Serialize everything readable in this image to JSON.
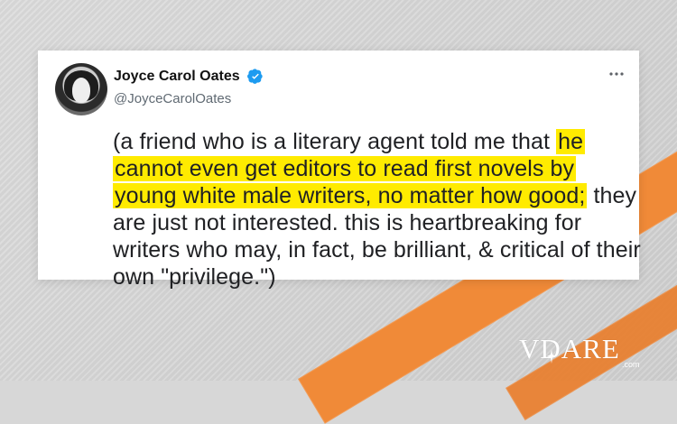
{
  "tweet": {
    "author_name": "Joyce Carol Oates",
    "handle": "@JoyceCarolOates",
    "text_before": "(a friend who is a literary agent told me that ",
    "text_highlight": "he cannot even get editors to read first novels by young white male writers, no matter how good;",
    "text_after": " they are just not interested. this is heartbreaking for writers who may, in fact, be brilliant, & critical of their own \"privilege.\")"
  },
  "brand": {
    "logo_text": "VDARE",
    "logo_suffix": ".com"
  },
  "icons": {
    "verified": "verified-badge-icon",
    "more": "more-options-icon"
  },
  "colors": {
    "background": "#d7d7d7",
    "card": "#ffffff",
    "highlight": "#ffeb00",
    "orange": "#f08a38",
    "verified_blue": "#1d9bf0"
  }
}
